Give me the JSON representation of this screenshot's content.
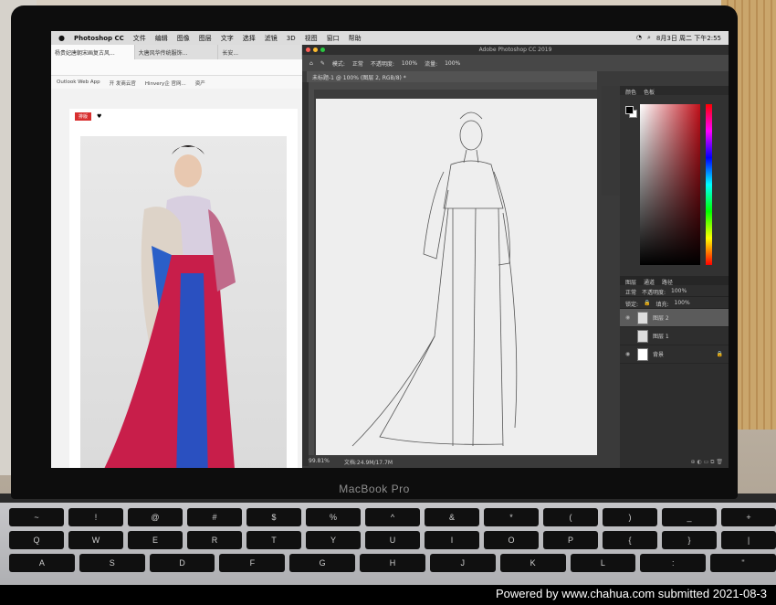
{
  "menubar": {
    "app": "Photoshop CC",
    "items": [
      "文件",
      "编辑",
      "图像",
      "图层",
      "文字",
      "选择",
      "滤镜",
      "3D",
      "视图",
      "窗口",
      "帮助"
    ],
    "clock": "8月3日 周二 下午2:55"
  },
  "browser": {
    "tabs": [
      "杨贵妃唐朝宋画复古风...",
      "大唐风华传统服饰...",
      "长安..."
    ],
    "bookmarks": [
      "Outlook Web App",
      "开 发商云官",
      "Hinvery企 官网...",
      "资产"
    ],
    "page_button": "排版"
  },
  "photoshop": {
    "window_title": "Adobe Photoshop CC 2019",
    "options_bar": {
      "mode_label": "模式:",
      "mode_value": "正常",
      "opacity_label": "不透明度:",
      "opacity_value": "100%",
      "flow_label": "流量:",
      "flow_value": "100%"
    },
    "document_tab": "未标题-1 @ 100% (图层 2, RGB/8) *",
    "status": {
      "zoom": "99.81%",
      "doc": "文档:24.9M/17.7M"
    },
    "panels": {
      "color_tabs": [
        "颜色",
        "色板"
      ],
      "layers_tabs": [
        "图层",
        "通道",
        "路径"
      ],
      "blend_mode": "正常",
      "opacity_label": "不透明度:",
      "opacity_value": "100%",
      "lock_label": "锁定:",
      "fill_label": "填充:",
      "fill_value": "100%",
      "layers": [
        {
          "name": "图层 2",
          "selected": true
        },
        {
          "name": "图层 1",
          "selected": false
        },
        {
          "name": "背景",
          "selected": false
        }
      ]
    }
  },
  "laptop": {
    "brand": "MacBook Pro"
  },
  "keyboard": {
    "row1": [
      "~",
      "!",
      "@",
      "#",
      "$",
      "%",
      "^",
      "&",
      "*",
      "(",
      ")",
      "_",
      "+"
    ],
    "row2": [
      "Q",
      "W",
      "E",
      "R",
      "T",
      "Y",
      "U",
      "I",
      "O",
      "P",
      "{",
      "}",
      "|"
    ],
    "row3": [
      "A",
      "S",
      "D",
      "F",
      "G",
      "H",
      "J",
      "K",
      "L",
      ":",
      "\""
    ]
  },
  "watermark": "Powered  by  www.chahua.com  submitted  2021-08-3"
}
